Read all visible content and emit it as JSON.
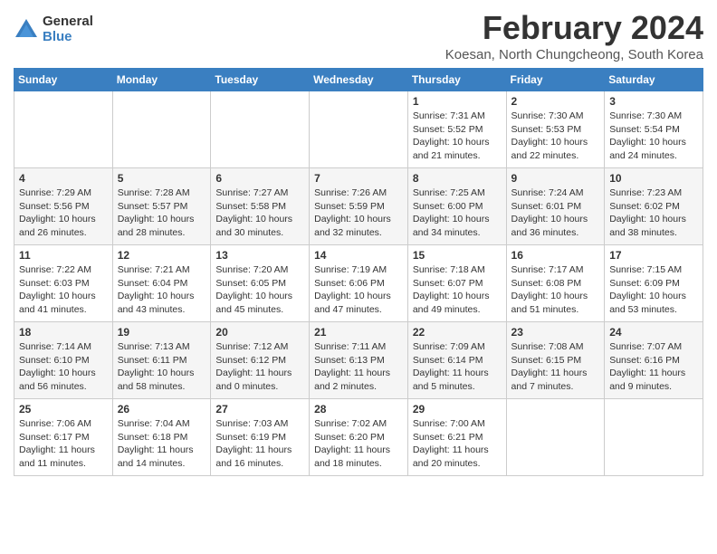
{
  "logo": {
    "general": "General",
    "blue": "Blue"
  },
  "title": "February 2024",
  "location": "Koesan, North Chungcheong, South Korea",
  "headers": [
    "Sunday",
    "Monday",
    "Tuesday",
    "Wednesday",
    "Thursday",
    "Friday",
    "Saturday"
  ],
  "weeks": [
    [
      {
        "day": "",
        "info": ""
      },
      {
        "day": "",
        "info": ""
      },
      {
        "day": "",
        "info": ""
      },
      {
        "day": "",
        "info": ""
      },
      {
        "day": "1",
        "info": "Sunrise: 7:31 AM\nSunset: 5:52 PM\nDaylight: 10 hours\nand 21 minutes."
      },
      {
        "day": "2",
        "info": "Sunrise: 7:30 AM\nSunset: 5:53 PM\nDaylight: 10 hours\nand 22 minutes."
      },
      {
        "day": "3",
        "info": "Sunrise: 7:30 AM\nSunset: 5:54 PM\nDaylight: 10 hours\nand 24 minutes."
      }
    ],
    [
      {
        "day": "4",
        "info": "Sunrise: 7:29 AM\nSunset: 5:56 PM\nDaylight: 10 hours\nand 26 minutes."
      },
      {
        "day": "5",
        "info": "Sunrise: 7:28 AM\nSunset: 5:57 PM\nDaylight: 10 hours\nand 28 minutes."
      },
      {
        "day": "6",
        "info": "Sunrise: 7:27 AM\nSunset: 5:58 PM\nDaylight: 10 hours\nand 30 minutes."
      },
      {
        "day": "7",
        "info": "Sunrise: 7:26 AM\nSunset: 5:59 PM\nDaylight: 10 hours\nand 32 minutes."
      },
      {
        "day": "8",
        "info": "Sunrise: 7:25 AM\nSunset: 6:00 PM\nDaylight: 10 hours\nand 34 minutes."
      },
      {
        "day": "9",
        "info": "Sunrise: 7:24 AM\nSunset: 6:01 PM\nDaylight: 10 hours\nand 36 minutes."
      },
      {
        "day": "10",
        "info": "Sunrise: 7:23 AM\nSunset: 6:02 PM\nDaylight: 10 hours\nand 38 minutes."
      }
    ],
    [
      {
        "day": "11",
        "info": "Sunrise: 7:22 AM\nSunset: 6:03 PM\nDaylight: 10 hours\nand 41 minutes."
      },
      {
        "day": "12",
        "info": "Sunrise: 7:21 AM\nSunset: 6:04 PM\nDaylight: 10 hours\nand 43 minutes."
      },
      {
        "day": "13",
        "info": "Sunrise: 7:20 AM\nSunset: 6:05 PM\nDaylight: 10 hours\nand 45 minutes."
      },
      {
        "day": "14",
        "info": "Sunrise: 7:19 AM\nSunset: 6:06 PM\nDaylight: 10 hours\nand 47 minutes."
      },
      {
        "day": "15",
        "info": "Sunrise: 7:18 AM\nSunset: 6:07 PM\nDaylight: 10 hours\nand 49 minutes."
      },
      {
        "day": "16",
        "info": "Sunrise: 7:17 AM\nSunset: 6:08 PM\nDaylight: 10 hours\nand 51 minutes."
      },
      {
        "day": "17",
        "info": "Sunrise: 7:15 AM\nSunset: 6:09 PM\nDaylight: 10 hours\nand 53 minutes."
      }
    ],
    [
      {
        "day": "18",
        "info": "Sunrise: 7:14 AM\nSunset: 6:10 PM\nDaylight: 10 hours\nand 56 minutes."
      },
      {
        "day": "19",
        "info": "Sunrise: 7:13 AM\nSunset: 6:11 PM\nDaylight: 10 hours\nand 58 minutes."
      },
      {
        "day": "20",
        "info": "Sunrise: 7:12 AM\nSunset: 6:12 PM\nDaylight: 11 hours\nand 0 minutes."
      },
      {
        "day": "21",
        "info": "Sunrise: 7:11 AM\nSunset: 6:13 PM\nDaylight: 11 hours\nand 2 minutes."
      },
      {
        "day": "22",
        "info": "Sunrise: 7:09 AM\nSunset: 6:14 PM\nDaylight: 11 hours\nand 5 minutes."
      },
      {
        "day": "23",
        "info": "Sunrise: 7:08 AM\nSunset: 6:15 PM\nDaylight: 11 hours\nand 7 minutes."
      },
      {
        "day": "24",
        "info": "Sunrise: 7:07 AM\nSunset: 6:16 PM\nDaylight: 11 hours\nand 9 minutes."
      }
    ],
    [
      {
        "day": "25",
        "info": "Sunrise: 7:06 AM\nSunset: 6:17 PM\nDaylight: 11 hours\nand 11 minutes."
      },
      {
        "day": "26",
        "info": "Sunrise: 7:04 AM\nSunset: 6:18 PM\nDaylight: 11 hours\nand 14 minutes."
      },
      {
        "day": "27",
        "info": "Sunrise: 7:03 AM\nSunset: 6:19 PM\nDaylight: 11 hours\nand 16 minutes."
      },
      {
        "day": "28",
        "info": "Sunrise: 7:02 AM\nSunset: 6:20 PM\nDaylight: 11 hours\nand 18 minutes."
      },
      {
        "day": "29",
        "info": "Sunrise: 7:00 AM\nSunset: 6:21 PM\nDaylight: 11 hours\nand 20 minutes."
      },
      {
        "day": "",
        "info": ""
      },
      {
        "day": "",
        "info": ""
      }
    ]
  ]
}
